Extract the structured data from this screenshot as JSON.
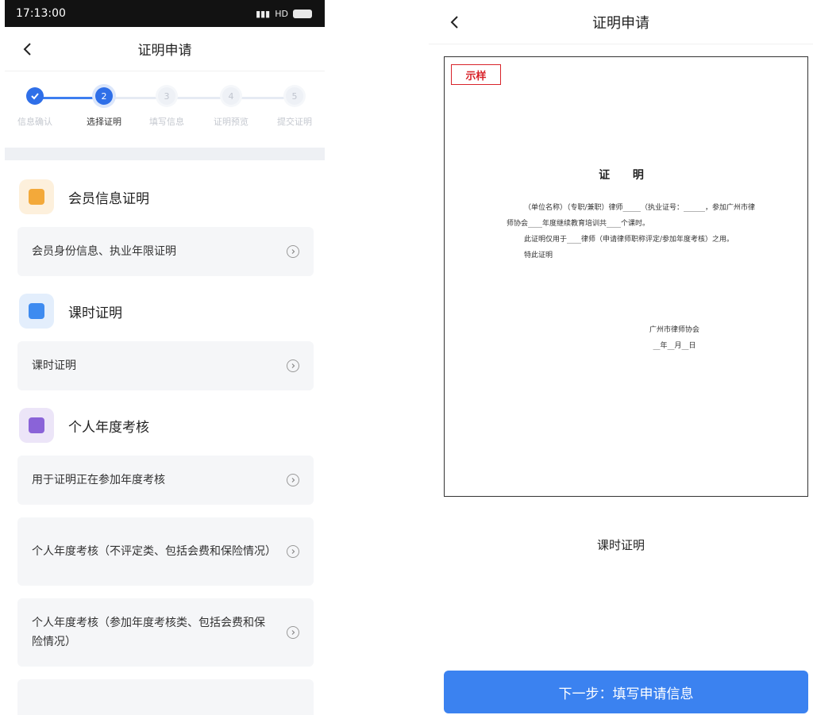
{
  "status_bar": {
    "time": "17:13:00",
    "indicators": "HD"
  },
  "left": {
    "title": "证明申请",
    "steps": [
      {
        "number": "",
        "label": "信息确认",
        "state": "done"
      },
      {
        "number": "2",
        "label": "选择证明",
        "state": "active"
      },
      {
        "number": "3",
        "label": "填写信息",
        "state": "todo"
      },
      {
        "number": "4",
        "label": "证明预览",
        "state": "todo"
      },
      {
        "number": "5",
        "label": "提交证明",
        "state": "todo"
      }
    ],
    "sections": [
      {
        "title": "会员信息证明",
        "icon": "member-card-icon",
        "icon_color": "#f3a93a",
        "items": [
          "会员身份信息、执业年限证明"
        ]
      },
      {
        "title": "课时证明",
        "icon": "calendar-icon",
        "icon_color": "#3e8bf0",
        "items": [
          "课时证明"
        ]
      },
      {
        "title": "个人年度考核",
        "icon": "profile-icon",
        "icon_color": "#8a63d8",
        "items": [
          "用于证明正在参加年度考核",
          "个人年度考核（不评定类、包括会费和保险情况）",
          "个人年度考核（参加年度考核类、包括会费和保险情况）"
        ]
      }
    ]
  },
  "right": {
    "title": "证明申请",
    "document": {
      "sample_stamp": "示样",
      "heading": "证 明",
      "para1": "（单位名称）（专职/兼职）律师_____（执业证号：______，参加广州市律师协会____年度继续教育培训共____个课时。",
      "para2": "此证明仅用于____律师（申请律师职称评定/参加年度考核）之用。",
      "para3": "特此证明",
      "signer": "广州市律师协会",
      "date_line": "__年__月__日"
    },
    "caption": "课时证明",
    "next_button": "下一步：填写申请信息"
  },
  "colors": {
    "primary": "#3b82f0",
    "stamp_red": "#d8232a"
  }
}
